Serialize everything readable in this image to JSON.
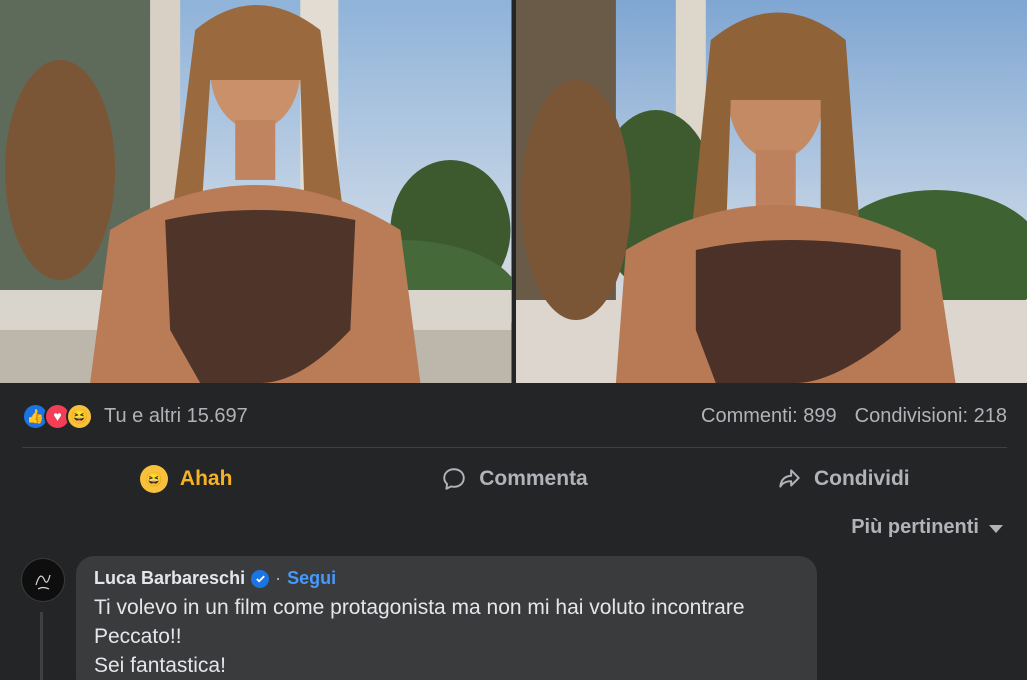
{
  "post": {
    "photos": [
      {
        "alt_icon": "photo-left"
      },
      {
        "alt_icon": "photo-right"
      }
    ],
    "reactions": {
      "icons": [
        "like-icon",
        "love-icon",
        "haha-icon"
      ],
      "summary": "Tu e altri 15.697"
    },
    "counts": {
      "comments": "Commenti: 899",
      "shares": "Condivisioni: 218"
    },
    "actions": {
      "react_label": "Ahah",
      "comment_label": "Commenta",
      "share_label": "Condividi"
    },
    "sort_label": "Più pertinenti"
  },
  "comment": {
    "author": "Luca Barbareschi",
    "separator": "·",
    "follow_label": "Segui",
    "lines": [
      "Ti volevo in un film come protagonista ma non mi hai voluto incontrare",
      "Peccato!!",
      "Sei fantastica!"
    ]
  },
  "colors": {
    "background": "#242526",
    "bubble": "#3a3b3c",
    "accent": "#1b74e4",
    "haha": "#f7b125",
    "text_secondary": "#b0b3b8"
  }
}
